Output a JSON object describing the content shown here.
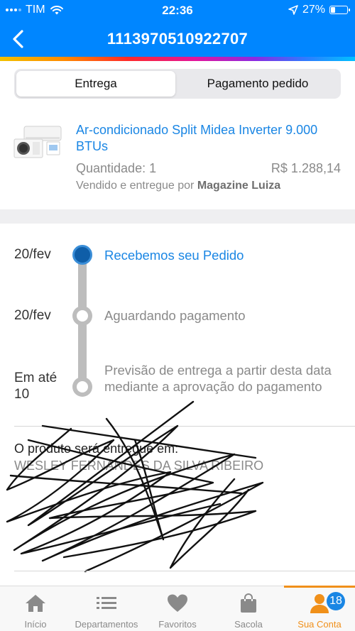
{
  "status_bar": {
    "carrier": "TIM",
    "time": "22:36",
    "battery": "27%",
    "battery_level": 0.27
  },
  "header": {
    "title": "1113970510922707"
  },
  "tabs": [
    {
      "label": "Entrega",
      "active": true
    },
    {
      "label": "Pagamento pedido",
      "active": false
    }
  ],
  "product": {
    "name": "Ar-condicionado Split Midea Inverter 9.000 BTUs",
    "quantity": "Quantidade: 1",
    "price": "R$ 1.288,14",
    "seller_prefix": "Vendido e entregue por",
    "seller_name": "Magazine Luiza"
  },
  "timeline": [
    {
      "date": "20/fev",
      "text": "Recebemos seu Pedido",
      "state": "done"
    },
    {
      "date": "20/fev",
      "text": "Aguardando pagamento",
      "state": "pending"
    },
    {
      "date": "Em até 10",
      "text": "Previsão de entrega a partir desta data mediante a aprovação do pagamento",
      "state": "pending"
    }
  ],
  "delivery": {
    "heading": "O produto será entregue em:",
    "recipient": "WESLEY FERNANDES DA SILVA RIBEIRO"
  },
  "bottom_nav": [
    {
      "label": "Início",
      "icon": "home-icon",
      "active": false
    },
    {
      "label": "Departamentos",
      "icon": "list-icon",
      "active": false
    },
    {
      "label": "Favoritos",
      "icon": "heart-icon",
      "active": false
    },
    {
      "label": "Sacola",
      "icon": "bag-icon",
      "active": false
    },
    {
      "label": "Sua Conta",
      "icon": "user-icon",
      "active": true,
      "badge": "18"
    }
  ],
  "colors": {
    "header_blue": "#0086ff",
    "link_blue": "#1a86e4",
    "active_orange": "#f0901a"
  }
}
